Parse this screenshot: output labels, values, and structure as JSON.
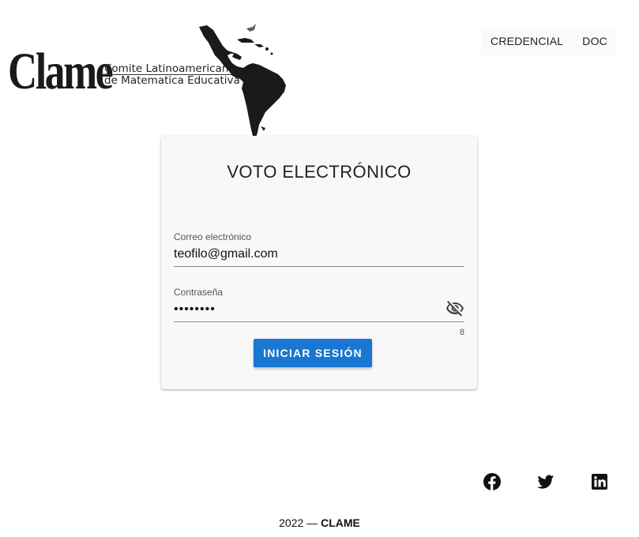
{
  "header": {
    "logo_word": "Clame",
    "logo_sub_line1": "Comite Latinoamericano",
    "logo_sub_line2": "de Matematica Educativa",
    "nav": [
      {
        "label": "CREDENCIAL"
      },
      {
        "label": "DOC"
      }
    ]
  },
  "login": {
    "title": "VOTO ELECTRÓNICO",
    "email_label": "Correo electrónico",
    "email_value": "teofilo@gmail.com",
    "password_label": "Contraseña",
    "password_value": "••••••••",
    "password_counter": "8",
    "submit_label": "INICIAR SESIÓN",
    "accent_color": "#1976d2"
  },
  "social": [
    {
      "icon": "facebook-icon"
    },
    {
      "icon": "twitter-icon"
    },
    {
      "icon": "linkedin-icon"
    }
  ],
  "footer": {
    "year": "2022 —",
    "brand": "CLAME"
  }
}
